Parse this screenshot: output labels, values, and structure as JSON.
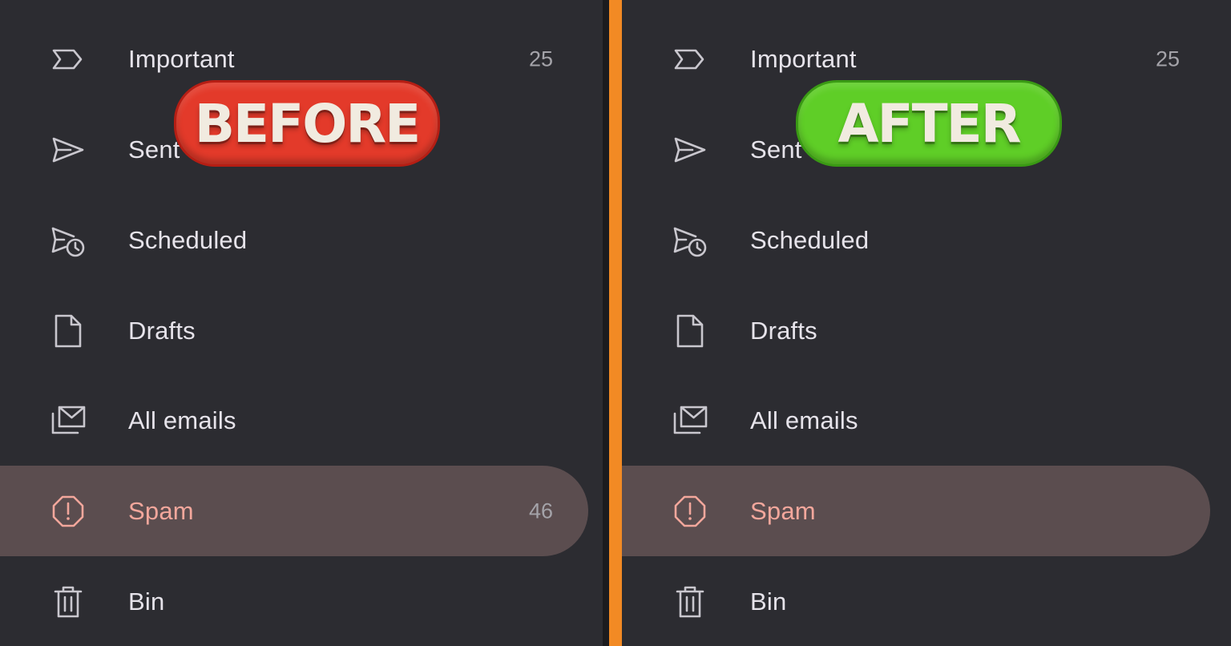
{
  "colors": {
    "panel_bg": "#2c2c31",
    "text": "#e6e3ea",
    "count": "#a4a3a9",
    "active_bg": "#5b4d4f",
    "active_text": "#f3a79c",
    "divider": "#f28a24",
    "before_badge": "#e33a2a",
    "after_badge": "#5fce27"
  },
  "badges": {
    "before": "BEFORE",
    "after": "AFTER"
  },
  "before_panel": {
    "items": [
      {
        "label": "Important",
        "count": "25",
        "icon": "important-icon"
      },
      {
        "label": "Sent",
        "count": "",
        "icon": "send-icon"
      },
      {
        "label": "Scheduled",
        "count": "",
        "icon": "scheduled-icon"
      },
      {
        "label": "Drafts",
        "count": "",
        "icon": "draft-icon"
      },
      {
        "label": "All emails",
        "count": "",
        "icon": "all-mail-icon"
      },
      {
        "label": "Spam",
        "count": "46",
        "icon": "spam-icon",
        "active": true
      },
      {
        "label": "Bin",
        "count": "",
        "icon": "trash-icon"
      }
    ]
  },
  "after_panel": {
    "items": [
      {
        "label": "Important",
        "count": "25",
        "icon": "important-icon"
      },
      {
        "label": "Sent",
        "count": "",
        "icon": "send-icon"
      },
      {
        "label": "Scheduled",
        "count": "",
        "icon": "scheduled-icon"
      },
      {
        "label": "Drafts",
        "count": "",
        "icon": "draft-icon"
      },
      {
        "label": "All emails",
        "count": "",
        "icon": "all-mail-icon"
      },
      {
        "label": "Spam",
        "count": "",
        "icon": "spam-icon",
        "active": true
      },
      {
        "label": "Bin",
        "count": "",
        "icon": "trash-icon"
      }
    ]
  }
}
